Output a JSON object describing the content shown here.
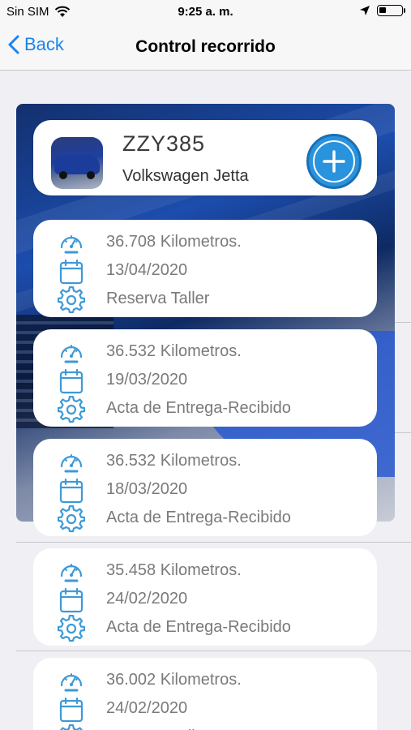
{
  "status_bar": {
    "carrier": "Sin SIM",
    "time": "9:25 a. m.",
    "battery_level": 0.3
  },
  "nav": {
    "back_label": "Back",
    "title": "Control recorrido"
  },
  "vehicle": {
    "plate": "ZZY385",
    "model": "Volkswagen Jetta"
  },
  "colors": {
    "accent": "#1a84ec",
    "icon": "#3d9ad6",
    "add_button": "#2a93de",
    "text_gray": "#7a7a7a"
  },
  "records": [
    {
      "km": "36.708 Kilometros.",
      "date": "13/04/2020",
      "type": "Reserva Taller"
    },
    {
      "km": "36.532 Kilometros.",
      "date": "19/03/2020",
      "type": "Acta de Entrega-Recibido"
    },
    {
      "km": "36.532 Kilometros.",
      "date": "18/03/2020",
      "type": "Acta de Entrega-Recibido"
    },
    {
      "km": "35.458 Kilometros.",
      "date": "24/02/2020",
      "type": "Acta de Entrega-Recibido"
    },
    {
      "km": "36.002 Kilometros.",
      "date": "24/02/2020",
      "type": "Reserva Taller"
    }
  ],
  "icons": {
    "odometer": "speedometer-icon",
    "date": "calendar-icon",
    "type": "gear-icon",
    "add": "plus-circle-icon",
    "back": "chevron-left-icon"
  }
}
